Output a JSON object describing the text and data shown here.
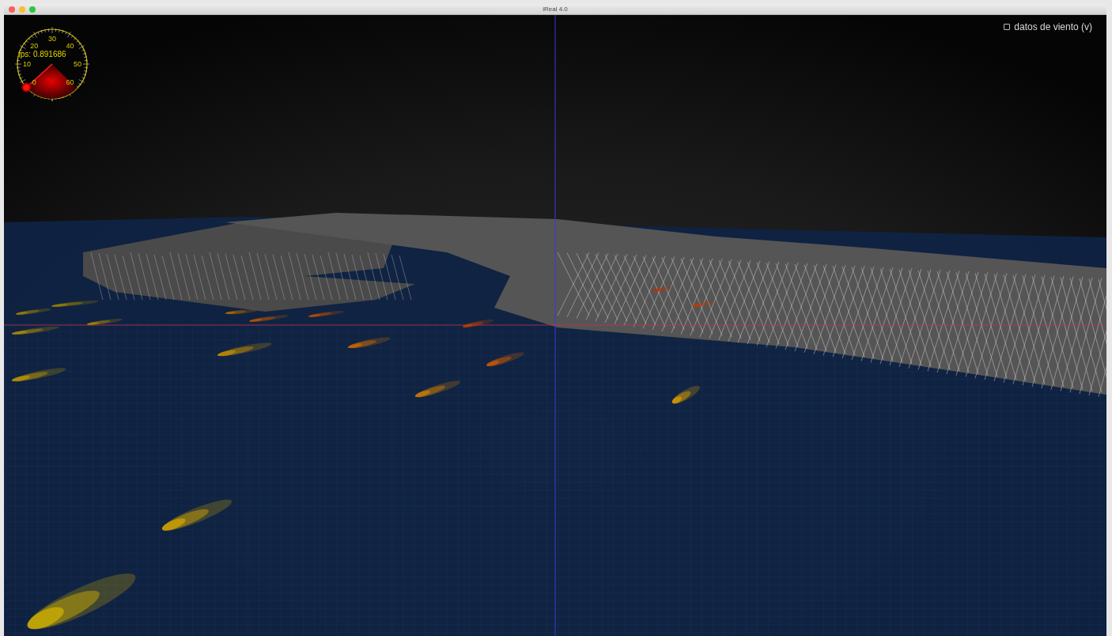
{
  "window": {
    "title": "iReal 4.0"
  },
  "gauge": {
    "reading": "fps: 0.891686",
    "labels": [
      "0",
      "10",
      "20",
      "30",
      "40",
      "50",
      "60"
    ]
  },
  "wind_toggle": {
    "label": "datos de viento (v)",
    "checked": false
  }
}
